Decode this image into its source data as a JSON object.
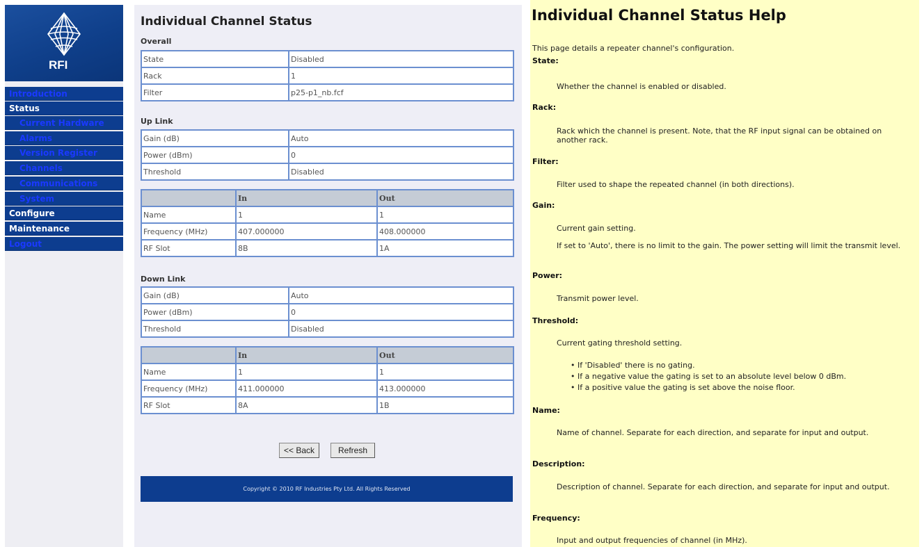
{
  "nav": {
    "logo_text": "RFI",
    "items": [
      {
        "label": "Introduction"
      },
      {
        "label": "Status"
      },
      {
        "label": "Current Hardware"
      },
      {
        "label": "Alarms"
      },
      {
        "label": "Version Register"
      },
      {
        "label": "Channels"
      },
      {
        "label": "Communications"
      },
      {
        "label": "System"
      },
      {
        "label": "Configure"
      },
      {
        "label": "Maintenance"
      },
      {
        "label": "Logout"
      }
    ]
  },
  "main": {
    "title": "Individual Channel Status",
    "overall": {
      "heading": "Overall",
      "rows": [
        {
          "key": "State",
          "value": "Disabled"
        },
        {
          "key": "Rack",
          "value": "1"
        },
        {
          "key": "Filter",
          "value": "p25-p1_nb.fcf"
        }
      ]
    },
    "uplink": {
      "heading": "Up Link",
      "rows": [
        {
          "key": "Gain (dB)",
          "value": "Auto"
        },
        {
          "key": "Power (dBm)",
          "value": "0"
        },
        {
          "key": "Threshold",
          "value": "Disabled"
        }
      ],
      "col_in": "In",
      "col_out": "Out",
      "io_rows": [
        {
          "key": "Name",
          "in": "1",
          "out": "1"
        },
        {
          "key": "Frequency (MHz)",
          "in": "407.000000",
          "out": "408.000000"
        },
        {
          "key": "RF Slot",
          "in": "8B",
          "out": "1A"
        }
      ]
    },
    "downlink": {
      "heading": "Down Link",
      "rows": [
        {
          "key": "Gain (dB)",
          "value": "Auto"
        },
        {
          "key": "Power (dBm)",
          "value": "0"
        },
        {
          "key": "Threshold",
          "value": "Disabled"
        }
      ],
      "col_in": "In",
      "col_out": "Out",
      "io_rows": [
        {
          "key": "Name",
          "in": "1",
          "out": "1"
        },
        {
          "key": "Frequency (MHz)",
          "in": "411.000000",
          "out": "413.000000"
        },
        {
          "key": "RF Slot",
          "in": "8A",
          "out": "1B"
        }
      ]
    },
    "back_label": "<< Back",
    "refresh_label": "Refresh",
    "footer": "Copyright © 2010 RF Industries Pty Ltd. All Rights Reserved"
  },
  "help": {
    "title": "Individual Channel Status Help",
    "intro": "This page details a repeater channel's configuration.",
    "state_head": "State:",
    "state_desc": "Whether the channel is enabled or disabled.",
    "rack_head": "Rack:",
    "rack_desc": "Rack which the channel is present. Note, that the RF input signal can be obtained on another rack.",
    "filter_head": "Filter:",
    "filter_desc": "Filter used to shape the repeated channel (in both directions).",
    "gain_head": "Gain:",
    "gain_desc1": "Current gain setting.",
    "gain_desc2": "If set to 'Auto', there is no limit to the gain. The power setting will limit the transmit level.",
    "power_head": "Power:",
    "power_desc": "Transmit power level.",
    "threshold_head": "Threshold:",
    "threshold_desc": "Current gating threshold setting.",
    "threshold_bullets": [
      "If 'Disabled' there is no gating.",
      "If a negative value the gating is set to an absolute level below 0 dBm.",
      "If a positive value the gating is set above the noise floor."
    ],
    "name_head": "Name:",
    "name_desc": "Name of channel. Separate for each direction, and separate for input and output.",
    "description_head": "Description:",
    "description_desc": "Description of channel. Separate for each direction, and separate for input and output.",
    "frequency_head": "Frequency:",
    "frequency_desc": "Input and output frequencies of channel (in MHz)."
  },
  "colors": {
    "nav_bg": "#0d3d8f",
    "nav_link": "#1a39ff",
    "table_border": "#6b8fd0",
    "help_bg": "#ffffc6"
  }
}
